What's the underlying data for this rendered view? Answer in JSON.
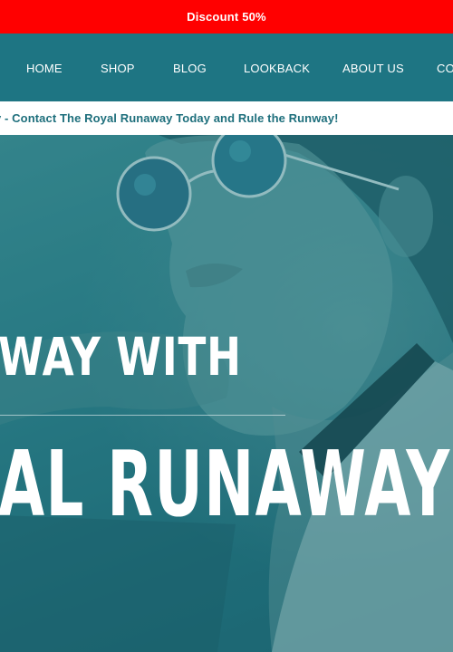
{
  "promo": {
    "text": "Discount 50%"
  },
  "nav": {
    "items": [
      {
        "label": "HOME"
      },
      {
        "label": "SHOP"
      },
      {
        "label": "BLOG"
      },
      {
        "label": "LOOKBACK"
      },
      {
        "label": "ABOUT US"
      },
      {
        "label": "CO"
      }
    ]
  },
  "ticker": {
    "text": "y - Contact The Royal Runaway Today and Rule the Runway!"
  },
  "hero": {
    "line1": "WAY WITH",
    "line2": "AL RUNAWAY!"
  },
  "colors": {
    "promo_bg": "#ff0000",
    "nav_bg": "#1e7583",
    "ticker_text": "#1e6f7c",
    "hero_overlay": "#1f6f7c"
  },
  "icons": [
    "sunglasses-photo"
  ]
}
